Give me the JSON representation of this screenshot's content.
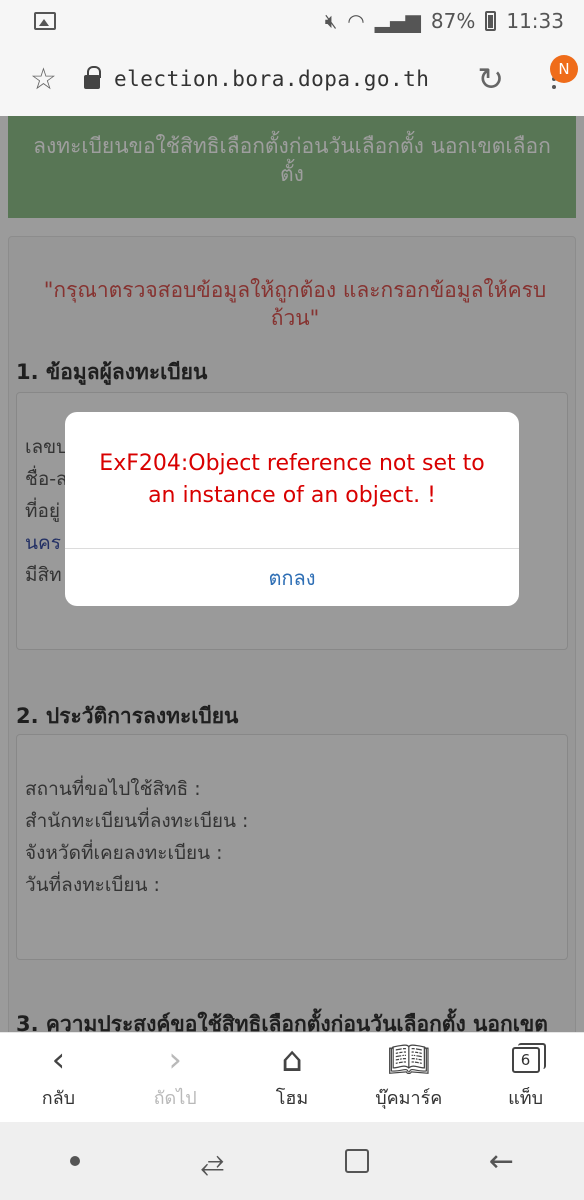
{
  "status": {
    "battery": "87%",
    "time": "11:33",
    "icons": [
      "image-icon",
      "mute-icon",
      "wifi-icon",
      "signal-icon",
      "battery-icon"
    ]
  },
  "browser": {
    "url": "election.bora.dopa.go.th",
    "notification_badge": "N"
  },
  "page": {
    "banner": "ลงทะเบียนขอใช้สิทธิเลือกตั้งก่อนวันเลือกตั้ง นอกเขตเลือกตั้ง",
    "notice": "\"กรุณาตรวจสอบข้อมูลให้ถูกต้อง และกรอกข้อมูลให้ครบถ้วน\"",
    "section1": {
      "title": "1. ข้อมูลผู้ลงทะเบียน",
      "fields": [
        "เลขบ",
        "ชื่อ-ส",
        "ที่อยู่",
        "นคร",
        "มีสิท"
      ]
    },
    "section2": {
      "title": "2. ประวัติการลงทะเบียน",
      "fields": [
        "สถานที่ขอไปใช้สิทธิ :",
        "สำนักทะเบียนที่ลงทะเบียน :",
        "จังหวัดที่เคยลงทะเบียน :",
        "วันที่ลงทะเบียน :"
      ]
    },
    "section3": {
      "title": "3. ความประสงค์ขอใช้สิทธิเลือกตั้งก่อนวันเลือกตั้ง นอกเขต"
    }
  },
  "dialog": {
    "message": "ExF204:Object reference not set to an instance of an object. !",
    "ok_label": "ตกลง"
  },
  "bottom_nav": {
    "back": "กลับ",
    "forward": "ถัดไป",
    "home": "โฮม",
    "bookmarks": "บุ๊คมาร์ค",
    "tabs": "แท็บ",
    "tab_count": "6"
  }
}
